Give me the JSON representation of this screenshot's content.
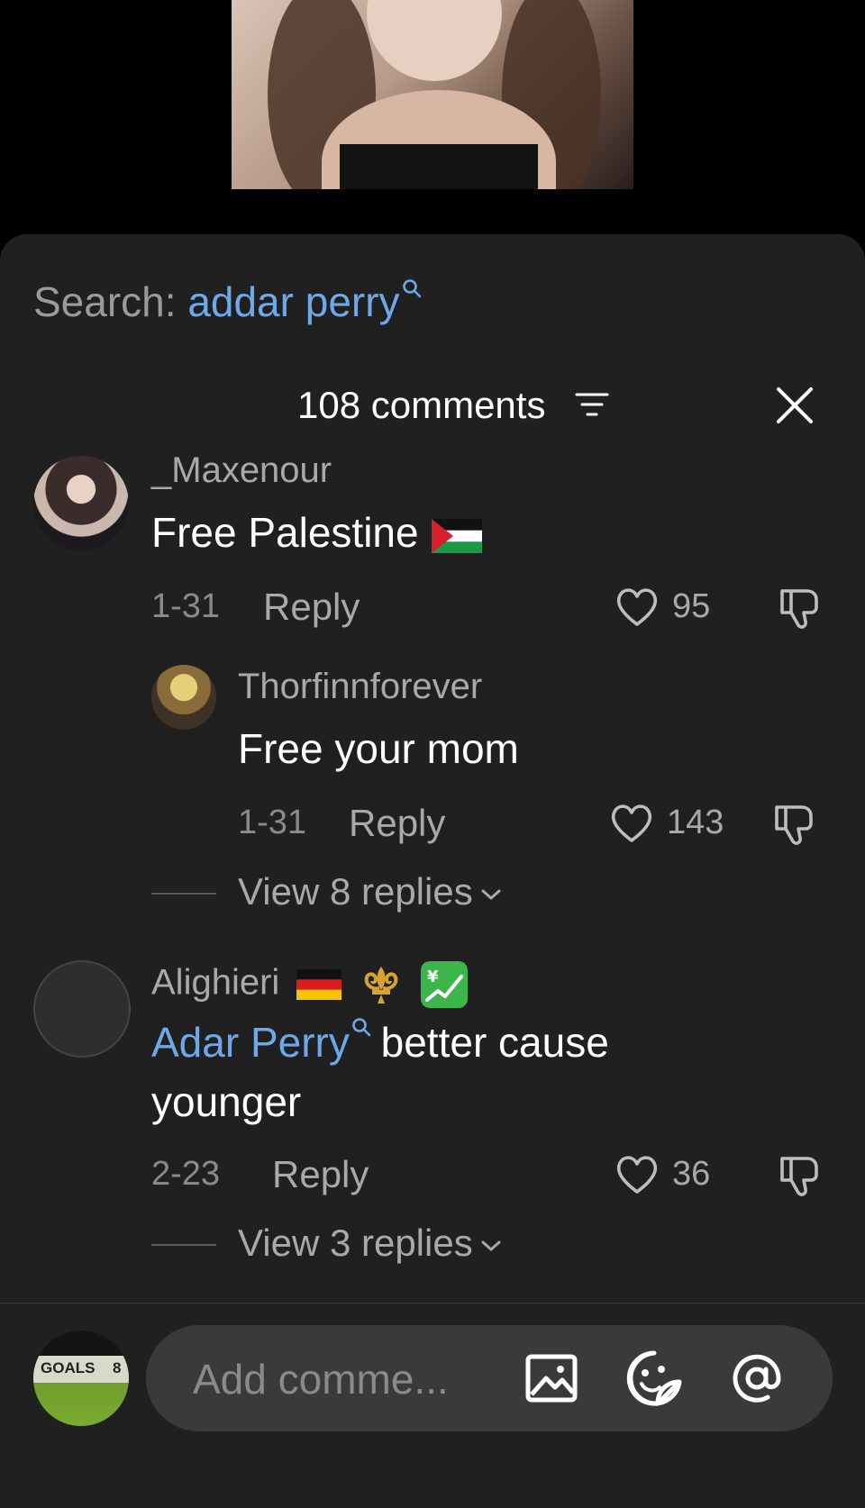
{
  "search": {
    "prefix": "Search: ",
    "query": "addar perry"
  },
  "header": {
    "comments_count": "108 comments"
  },
  "comments": [
    {
      "username": "_Maxenour",
      "text": "Free Palestine",
      "flag": "palestine-flag",
      "date": "1-31",
      "reply_label": "Reply",
      "likes": "95"
    },
    {
      "username": "Thorfinnforever",
      "text": "Free your mom",
      "date": "1-31",
      "reply_label": "Reply",
      "likes": "143",
      "view_replies": "View 8 replies"
    },
    {
      "username": "Alighieri",
      "username_emojis": [
        "germany-flag",
        "fleur-de-lis",
        "chart-yen"
      ],
      "mention": "Adar Perry",
      "text_line1": " better cause",
      "text_line2": "younger",
      "date": "2-23",
      "reply_label": "Reply",
      "likes": "36",
      "view_replies": "View 3 replies"
    }
  ],
  "composer": {
    "placeholder": "Add comme...",
    "avatar_text_left": "GOALS",
    "avatar_text_right": "8"
  },
  "colors": {
    "sheet_bg": "#202020",
    "link_blue": "#6ea8e8",
    "muted": "#a9a9a9",
    "input_bg": "#3a3a3a"
  }
}
